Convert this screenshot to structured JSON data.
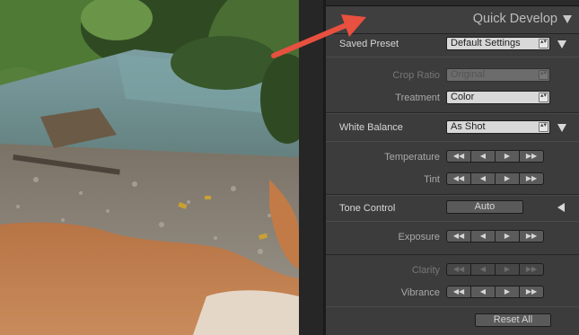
{
  "panel": {
    "title": "Quick Develop",
    "saved_preset": {
      "label": "Saved Preset",
      "value": "Default Settings"
    },
    "crop_ratio": {
      "label": "Crop Ratio",
      "value": "Original"
    },
    "treatment": {
      "label": "Treatment",
      "value": "Color"
    },
    "white_balance": {
      "label": "White Balance",
      "value": "As Shot"
    },
    "temperature": {
      "label": "Temperature"
    },
    "tint": {
      "label": "Tint"
    },
    "tone_control": {
      "label": "Tone Control",
      "auto_label": "Auto"
    },
    "exposure": {
      "label": "Exposure"
    },
    "clarity": {
      "label": "Clarity"
    },
    "vibrance": {
      "label": "Vibrance"
    },
    "reset_all": "Reset All",
    "step_glyphs": [
      "◀◀",
      "◀",
      "▶",
      "▶▶"
    ],
    "spin_glyph": "▴▾"
  },
  "colors": {
    "panel_bg": "#3c3c3c",
    "arrow": "#e8503f"
  }
}
